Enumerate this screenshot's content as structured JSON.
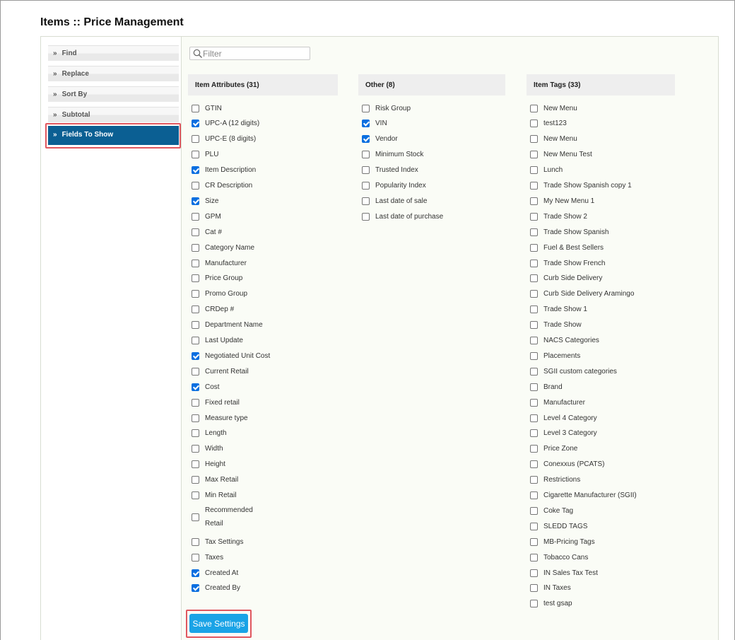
{
  "page": {
    "title": "Items :: Price Management"
  },
  "sidebar": {
    "items": [
      {
        "label": "Find"
      },
      {
        "label": "Replace"
      },
      {
        "label": "Sort By"
      },
      {
        "label": "Subtotal"
      },
      {
        "label": "Fields To Show"
      }
    ],
    "chevron": "»"
  },
  "filter": {
    "placeholder": "Filter"
  },
  "columns": [
    {
      "header": "Item Attributes (31)",
      "items": [
        {
          "label": "GTIN",
          "checked": false
        },
        {
          "label": "UPC-A (12 digits)",
          "checked": true
        },
        {
          "label": "UPC-E (8 digits)",
          "checked": false
        },
        {
          "label": "PLU",
          "checked": false
        },
        {
          "label": "Item Description",
          "checked": true
        },
        {
          "label": "CR Description",
          "checked": false
        },
        {
          "label": "Size",
          "checked": true
        },
        {
          "label": "GPM",
          "checked": false
        },
        {
          "label": "Cat #",
          "checked": false
        },
        {
          "label": "Category Name",
          "checked": false
        },
        {
          "label": "Manufacturer",
          "checked": false
        },
        {
          "label": "Price Group",
          "checked": false
        },
        {
          "label": "Promo Group",
          "checked": false
        },
        {
          "label": "CRDep #",
          "checked": false
        },
        {
          "label": "Department Name",
          "checked": false
        },
        {
          "label": "Last Update",
          "checked": false
        },
        {
          "label": "Negotiated Unit Cost",
          "checked": true
        },
        {
          "label": "Current Retail",
          "checked": false
        },
        {
          "label": "Cost",
          "checked": true
        },
        {
          "label": "Fixed retail",
          "checked": false
        },
        {
          "label": "Measure type",
          "checked": false
        },
        {
          "label": "Length",
          "checked": false
        },
        {
          "label": "Width",
          "checked": false
        },
        {
          "label": "Height",
          "checked": false
        },
        {
          "label": "Max Retail",
          "checked": false
        },
        {
          "label": "Min Retail",
          "checked": false
        },
        {
          "label": "Recommended Retail",
          "checked": false,
          "multi": true
        },
        {
          "label": "Tax Settings",
          "checked": false
        },
        {
          "label": "Taxes",
          "checked": false
        },
        {
          "label": "Created At",
          "checked": true
        },
        {
          "label": "Created By",
          "checked": true
        }
      ]
    },
    {
      "header": "Other (8)",
      "items": [
        {
          "label": "Risk Group",
          "checked": false
        },
        {
          "label": "VIN",
          "checked": true
        },
        {
          "label": "Vendor",
          "checked": true
        },
        {
          "label": "Minimum Stock",
          "checked": false
        },
        {
          "label": "Trusted Index",
          "checked": false
        },
        {
          "label": "Popularity Index",
          "checked": false
        },
        {
          "label": "Last date of sale",
          "checked": false
        },
        {
          "label": "Last date of purchase",
          "checked": false
        }
      ]
    },
    {
      "header": "Item Tags (33)",
      "items": [
        {
          "label": "New Menu",
          "checked": false
        },
        {
          "label": "test123",
          "checked": false
        },
        {
          "label": "New Menu",
          "checked": false
        },
        {
          "label": "New Menu Test",
          "checked": false
        },
        {
          "label": "Lunch",
          "checked": false
        },
        {
          "label": "Trade Show Spanish copy 1",
          "checked": false
        },
        {
          "label": "My New Menu 1",
          "checked": false
        },
        {
          "label": "Trade Show 2",
          "checked": false
        },
        {
          "label": "Trade Show Spanish",
          "checked": false
        },
        {
          "label": "Fuel & Best Sellers",
          "checked": false
        },
        {
          "label": "Trade Show French",
          "checked": false
        },
        {
          "label": "Curb Side Delivery",
          "checked": false
        },
        {
          "label": "Curb Side Delivery Aramingo",
          "checked": false
        },
        {
          "label": "Trade Show 1",
          "checked": false
        },
        {
          "label": "Trade Show",
          "checked": false
        },
        {
          "label": "NACS Categories",
          "checked": false
        },
        {
          "label": "Placements",
          "checked": false
        },
        {
          "label": "SGII custom categories",
          "checked": false
        },
        {
          "label": "Brand",
          "checked": false
        },
        {
          "label": "Manufacturer",
          "checked": false
        },
        {
          "label": "Level 4 Category",
          "checked": false
        },
        {
          "label": "Level 3 Category",
          "checked": false
        },
        {
          "label": "Price Zone",
          "checked": false
        },
        {
          "label": "Conexxus (PCATS)",
          "checked": false
        },
        {
          "label": "Restrictions",
          "checked": false
        },
        {
          "label": "Cigarette Manufacturer (SGII)",
          "checked": false
        },
        {
          "label": "Coke Tag",
          "checked": false
        },
        {
          "label": "SLEDD TAGS",
          "checked": false
        },
        {
          "label": "MB-Pricing Tags",
          "checked": false
        },
        {
          "label": "Tobacco Cans",
          "checked": false
        },
        {
          "label": "IN Sales Tax Test",
          "checked": false
        },
        {
          "label": "IN Taxes",
          "checked": false
        },
        {
          "label": "test gsap",
          "checked": false
        }
      ]
    }
  ],
  "actions": {
    "save_label": "Save Settings"
  },
  "colors": {
    "active_tab": "#0b5f93",
    "save_button": "#1aa3e6",
    "checkbox_on": "#0a6fe0",
    "highlight": "#e0575f"
  },
  "icons": {
    "filter": "search-icon",
    "checkbox": "checkbox-icon"
  }
}
